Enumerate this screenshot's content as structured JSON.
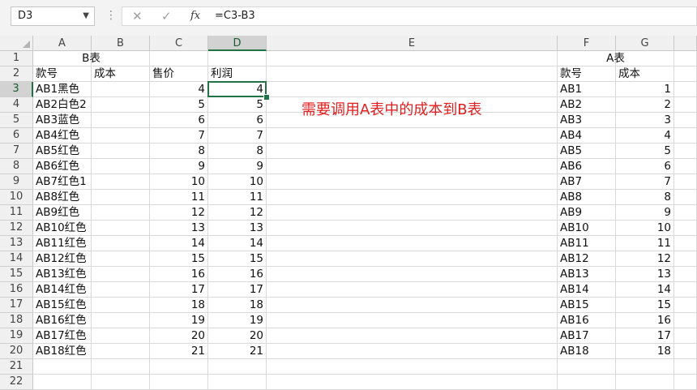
{
  "formula_bar": {
    "name_box": "D3",
    "cancel_icon": "✕",
    "enter_icon": "✓",
    "fx_label": "fx",
    "formula": "=C3-B3"
  },
  "columns": [
    "A",
    "B",
    "C",
    "D",
    "E",
    "F",
    "G"
  ],
  "rows": [
    "1",
    "2",
    "3",
    "4",
    "5",
    "6",
    "7",
    "8",
    "9",
    "10",
    "11",
    "12",
    "13",
    "14",
    "15",
    "16",
    "17",
    "18",
    "19",
    "20",
    "21",
    "22"
  ],
  "sheet": {
    "b_table_title": "B表",
    "a_table_title": "A表",
    "b_headers": [
      "款号",
      "成本",
      "售价",
      "利润"
    ],
    "a_headers": [
      "款号",
      "成本"
    ],
    "b_rows": [
      [
        "AB1黑色",
        "",
        "4",
        "4"
      ],
      [
        "AB2白色2",
        "",
        "5",
        "5"
      ],
      [
        "AB3蓝色",
        "",
        "6",
        "6"
      ],
      [
        "AB4红色",
        "",
        "7",
        "7"
      ],
      [
        "AB5红色",
        "",
        "8",
        "8"
      ],
      [
        "AB6红色",
        "",
        "9",
        "9"
      ],
      [
        "AB7红色1",
        "",
        "10",
        "10"
      ],
      [
        "AB8红色",
        "",
        "11",
        "11"
      ],
      [
        "AB9红色",
        "",
        "12",
        "12"
      ],
      [
        "AB10红色",
        "",
        "13",
        "13"
      ],
      [
        "AB11红色",
        "",
        "14",
        "14"
      ],
      [
        "AB12红色",
        "",
        "15",
        "15"
      ],
      [
        "AB13红色",
        "",
        "16",
        "16"
      ],
      [
        "AB14红色",
        "",
        "17",
        "17"
      ],
      [
        "AB15红色",
        "",
        "18",
        "18"
      ],
      [
        "AB16红色",
        "",
        "19",
        "19"
      ],
      [
        "AB17红色",
        "",
        "20",
        "20"
      ],
      [
        "AB18红色",
        "",
        "21",
        "21"
      ]
    ],
    "a_rows": [
      [
        "AB1",
        "1"
      ],
      [
        "AB2",
        "2"
      ],
      [
        "AB3",
        "3"
      ],
      [
        "AB4",
        "4"
      ],
      [
        "AB5",
        "5"
      ],
      [
        "AB6",
        "6"
      ],
      [
        "AB7",
        "7"
      ],
      [
        "AB8",
        "8"
      ],
      [
        "AB9",
        "9"
      ],
      [
        "AB10",
        "10"
      ],
      [
        "AB11",
        "11"
      ],
      [
        "AB12",
        "12"
      ],
      [
        "AB13",
        "13"
      ],
      [
        "AB14",
        "14"
      ],
      [
        "AB15",
        "15"
      ],
      [
        "AB16",
        "16"
      ],
      [
        "AB17",
        "17"
      ],
      [
        "AB18",
        "18"
      ]
    ],
    "note": "需要调用A表中的成本到B表"
  },
  "colors": {
    "accent": "#217346",
    "note": "#e02020"
  }
}
